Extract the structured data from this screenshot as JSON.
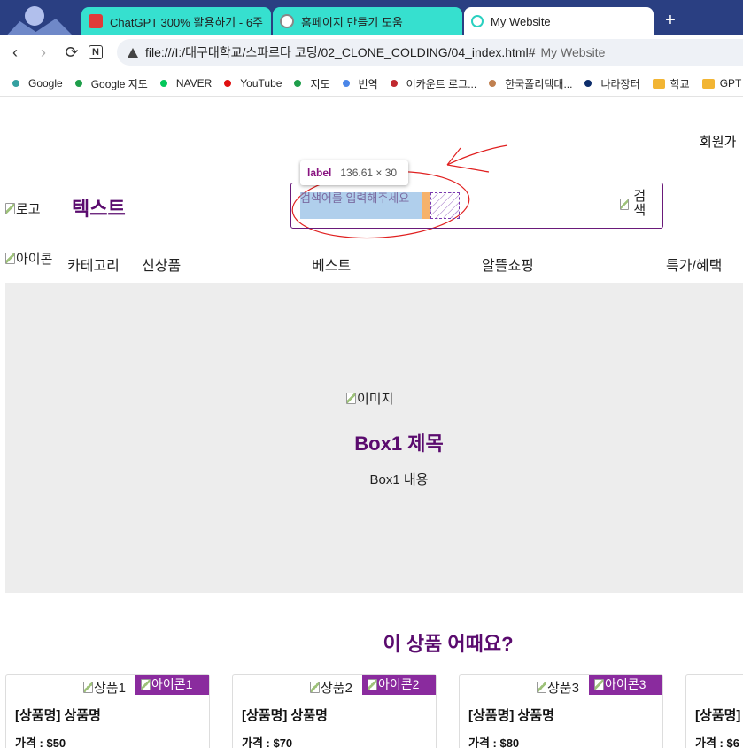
{
  "tabs": [
    {
      "title": "ChatGPT 300% 활용하기 - 6주",
      "close": "×",
      "icon": "notion-book-icon",
      "color": "#e03a3a"
    },
    {
      "title": "홈페이지 만들기 도움",
      "close": "×",
      "icon": "chatgpt-icon",
      "color": "#888888"
    },
    {
      "title": "My Website",
      "close": "×",
      "icon": "page-icon",
      "color": "#2ad0c0"
    }
  ],
  "new_tab": "+",
  "toolbar": {
    "back": "‹",
    "forward": "›",
    "reload": "⟳",
    "ext": "N",
    "url": "file:///I:/대구대학교/스파르타 코딩/02_CLONE_COLDING/04_index.html#",
    "page_title": "My Website"
  },
  "bookmarks": [
    {
      "label": "Google",
      "color": "#34a0a0",
      "kind": "dot"
    },
    {
      "label": "Google 지도",
      "color": "#1e9e4a",
      "kind": "dot"
    },
    {
      "label": "NAVER",
      "color": "#03c75a",
      "kind": "dot"
    },
    {
      "label": "YouTube",
      "color": "#e01010",
      "kind": "dot"
    },
    {
      "label": "지도",
      "color": "#1e9e4a",
      "kind": "dot"
    },
    {
      "label": "번역",
      "color": "#4a86e8",
      "kind": "dot"
    },
    {
      "label": "이카운트 로그...",
      "color": "#c0282f",
      "kind": "dot"
    },
    {
      "label": "한국폴리텍대...",
      "color": "#c08050",
      "kind": "dot"
    },
    {
      "label": "나라장터",
      "color": "#0d2d6b",
      "kind": "dot"
    },
    {
      "label": "학교",
      "color": "#f2b533",
      "kind": "folder"
    },
    {
      "label": "GPT",
      "color": "#f2b533",
      "kind": "folder"
    }
  ],
  "header": {
    "signup": "회원가",
    "logo_alt": "로고",
    "logo_text": "텍스트",
    "search_label": "검색어를 입력해주세요",
    "search_button_alt": "검색",
    "tooltip_tag": "label",
    "tooltip_size": "136.61 × 30"
  },
  "nav": {
    "icon_alt": "아이콘",
    "items": [
      "카테고리",
      "신상품",
      "베스트",
      "알뜰쇼핑",
      "특가/혜택"
    ]
  },
  "hero": {
    "image_alt": "이미지",
    "title": "Box1 제목",
    "body": "Box1 내용"
  },
  "products": {
    "section_title": "이 상품 어때요?",
    "items": [
      {
        "img_alt": "상품1",
        "icon_alt": "아이콘1",
        "name": "[상품명] 상품명",
        "price": "가격 : $50"
      },
      {
        "img_alt": "상품2",
        "icon_alt": "아이콘2",
        "name": "[상품명] 상품명",
        "price": "가격 : $70"
      },
      {
        "img_alt": "상품3",
        "icon_alt": "아이콘3",
        "name": "[상품명] 상품명",
        "price": "가격 : $80"
      },
      {
        "img_alt": "",
        "icon_alt": "",
        "name": "[상품명] 상품명",
        "price": "가격 : $6"
      }
    ]
  },
  "colors": {
    "accent": "#5a0b6e",
    "badge": "#8a2b9e",
    "hero_bg": "#ededed",
    "tabstrip": "#2a3f82",
    "tab_inactive": "#36e0cf"
  }
}
